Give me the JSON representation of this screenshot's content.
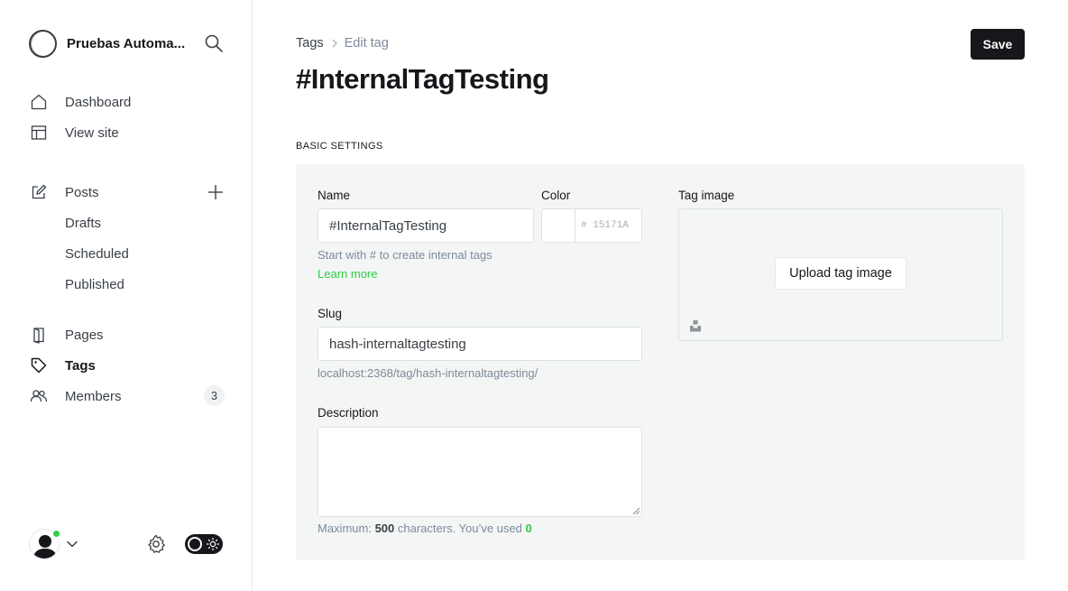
{
  "sidebar": {
    "site_name": "Pruebas Automa...",
    "nav": {
      "dashboard": "Dashboard",
      "view_site": "View site",
      "posts": "Posts",
      "drafts": "Drafts",
      "scheduled": "Scheduled",
      "published": "Published",
      "pages": "Pages",
      "tags": "Tags",
      "members": "Members",
      "members_count": "3"
    },
    "theme_toggle": "dark-mode-toggle-on"
  },
  "header": {
    "breadcrumb_parent": "Tags",
    "breadcrumb_current": "Edit tag",
    "title": "#InternalTagTesting",
    "save_label": "Save"
  },
  "basic_settings": {
    "section_label": "BASIC SETTINGS",
    "name_label": "Name",
    "name_value": "#InternalTagTesting",
    "name_hint": "Start with # to create internal tags",
    "learn_more": "Learn more",
    "color_label": "Color",
    "color_placeholder": "# 15171A",
    "slug_label": "Slug",
    "slug_value": "hash-internaltagtesting",
    "slug_url": "localhost:2368/tag/hash-internaltagtesting/",
    "description_label": "Description",
    "description_value": "",
    "counter_prefix": "Maximum: ",
    "counter_max": "500",
    "counter_mid": " characters. You’ve used ",
    "counter_used": "0",
    "tag_image_label": "Tag image",
    "upload_label": "Upload tag image"
  },
  "colors": {
    "accent": "#30cf43",
    "primary_button": "#15171a",
    "panel_background": "#f4f5f5"
  }
}
